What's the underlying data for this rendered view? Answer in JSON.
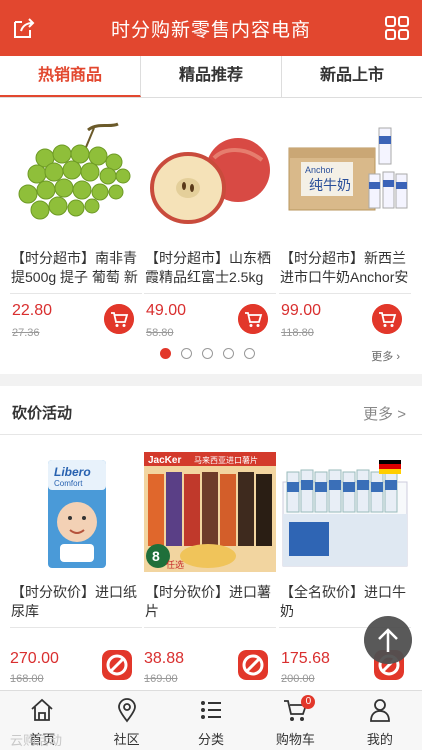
{
  "header": {
    "title": "时分购新零售内容电商",
    "accent": "#e2472f"
  },
  "tabs": [
    {
      "label": "热销商品"
    },
    {
      "label": "精品推荐"
    },
    {
      "label": "新品上市"
    }
  ],
  "hot": {
    "products": [
      {
        "name": "【时分超市】南非青提500g 提子 葡萄 新",
        "price": "22.80",
        "old_price": "27.36",
        "image": "green-grapes"
      },
      {
        "name": "【时分超市】山东栖霞精品红富士2.5kg",
        "price": "49.00",
        "old_price": "58.80",
        "image": "red-apples"
      },
      {
        "name": "【时分超市】新西兰进市口牛奶Anchor安",
        "price": "99.00",
        "old_price": "118.80",
        "image": "anchor-milk"
      }
    ],
    "more": "更多"
  },
  "bargain": {
    "title": "砍价活动",
    "more": "更多",
    "products": [
      {
        "name": "【时分砍价】进口纸尿库",
        "price": "270.00",
        "old_price": "168.00",
        "image": "libero-diapers"
      },
      {
        "name": "【时分砍价】进口薯片",
        "price": "38.88",
        "old_price": "169.00",
        "image": "jacker-chips"
      },
      {
        "name": "【全名砍价】进口牛奶",
        "price": "175.68",
        "old_price": "200.00",
        "image": "milk-cartons"
      }
    ],
    "image_text": {
      "libero_brand": "Libero",
      "libero_sub": "Comfort",
      "jacker_brand": "JacKer",
      "jacker_banner": "马来西亚进口薯片",
      "jacker_offer": "任选",
      "anchor_brand": "Anchor",
      "anchor_box": "纯牛奶"
    }
  },
  "bottom_nav": [
    {
      "label": "首页",
      "icon": "home-icon"
    },
    {
      "label": "社区",
      "icon": "location-icon"
    },
    {
      "label": "分类",
      "icon": "list-icon"
    },
    {
      "label": "购物车",
      "icon": "cart-icon",
      "badge": "0"
    },
    {
      "label": "我的",
      "icon": "user-icon"
    }
  ],
  "ghost_text": "云购活动"
}
